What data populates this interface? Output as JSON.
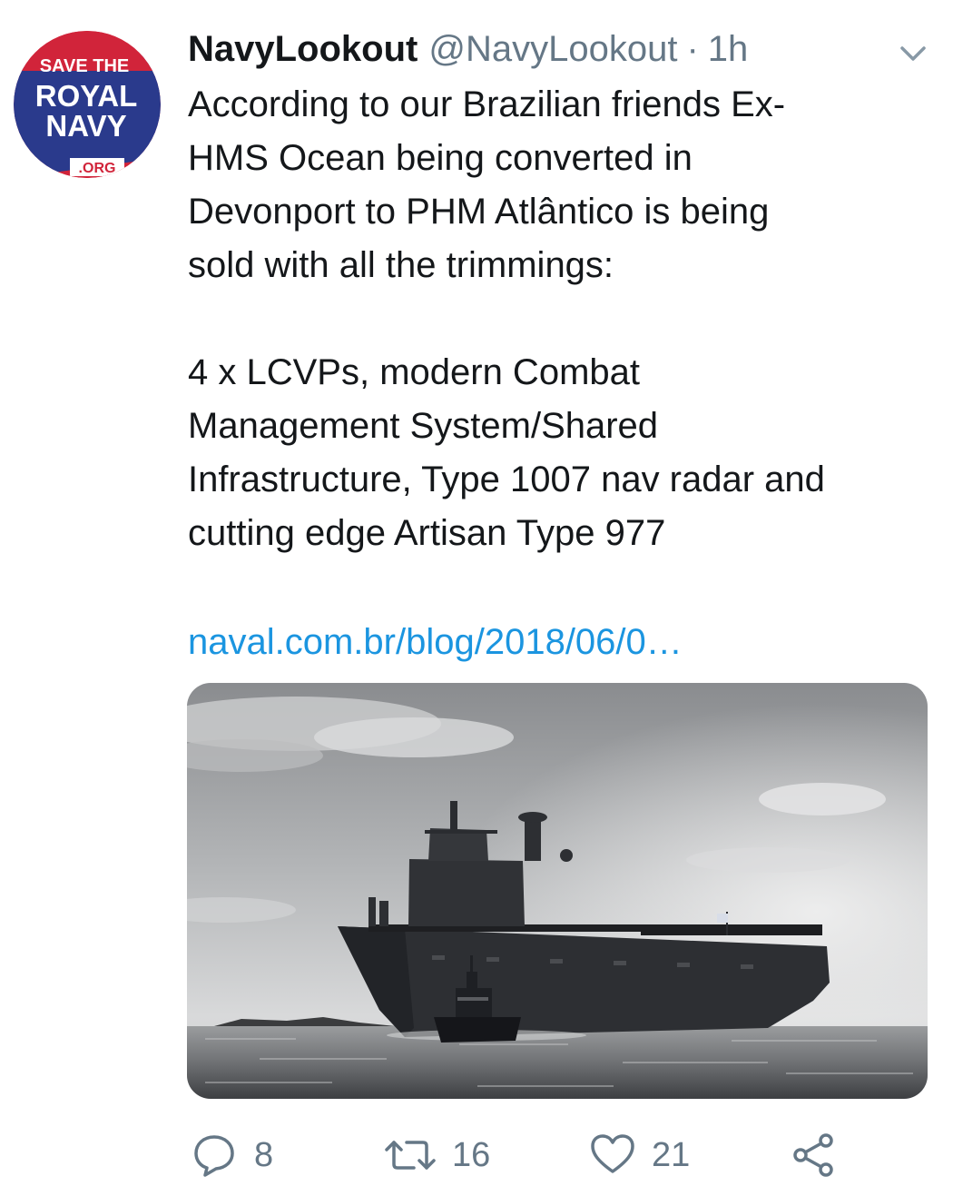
{
  "tweet": {
    "avatar": {
      "line1": "SAVE THE",
      "line2": "ROYAL",
      "line3": "NAVY",
      "line4": ".ORG",
      "colors": {
        "blue": "#2a3a8c",
        "red": "#d1243a",
        "white": "#ffffff"
      }
    },
    "display_name": "NavyLookout",
    "handle": "@NavyLookout",
    "separator": "·",
    "time": "1h",
    "text": "According to our Brazilian friends Ex-\nHMS Ocean being converted in\nDevonport to PHM Atlântico is being\nsold with all the trimmings:\n\n4 x LCVPs, modern Combat\nManagement System/Shared\nInfrastructure, Type 1007 nav radar and\ncutting edge Artisan Type 977",
    "link_text": "naval.com.br/blog/2018/06/0…",
    "media": {
      "icon": "ship-photo"
    },
    "actions": {
      "reply_count": "8",
      "retweet_count": "16",
      "like_count": "21"
    },
    "colors": {
      "text": "#14171a",
      "secondary": "#657786",
      "link": "#1b95e0"
    }
  }
}
